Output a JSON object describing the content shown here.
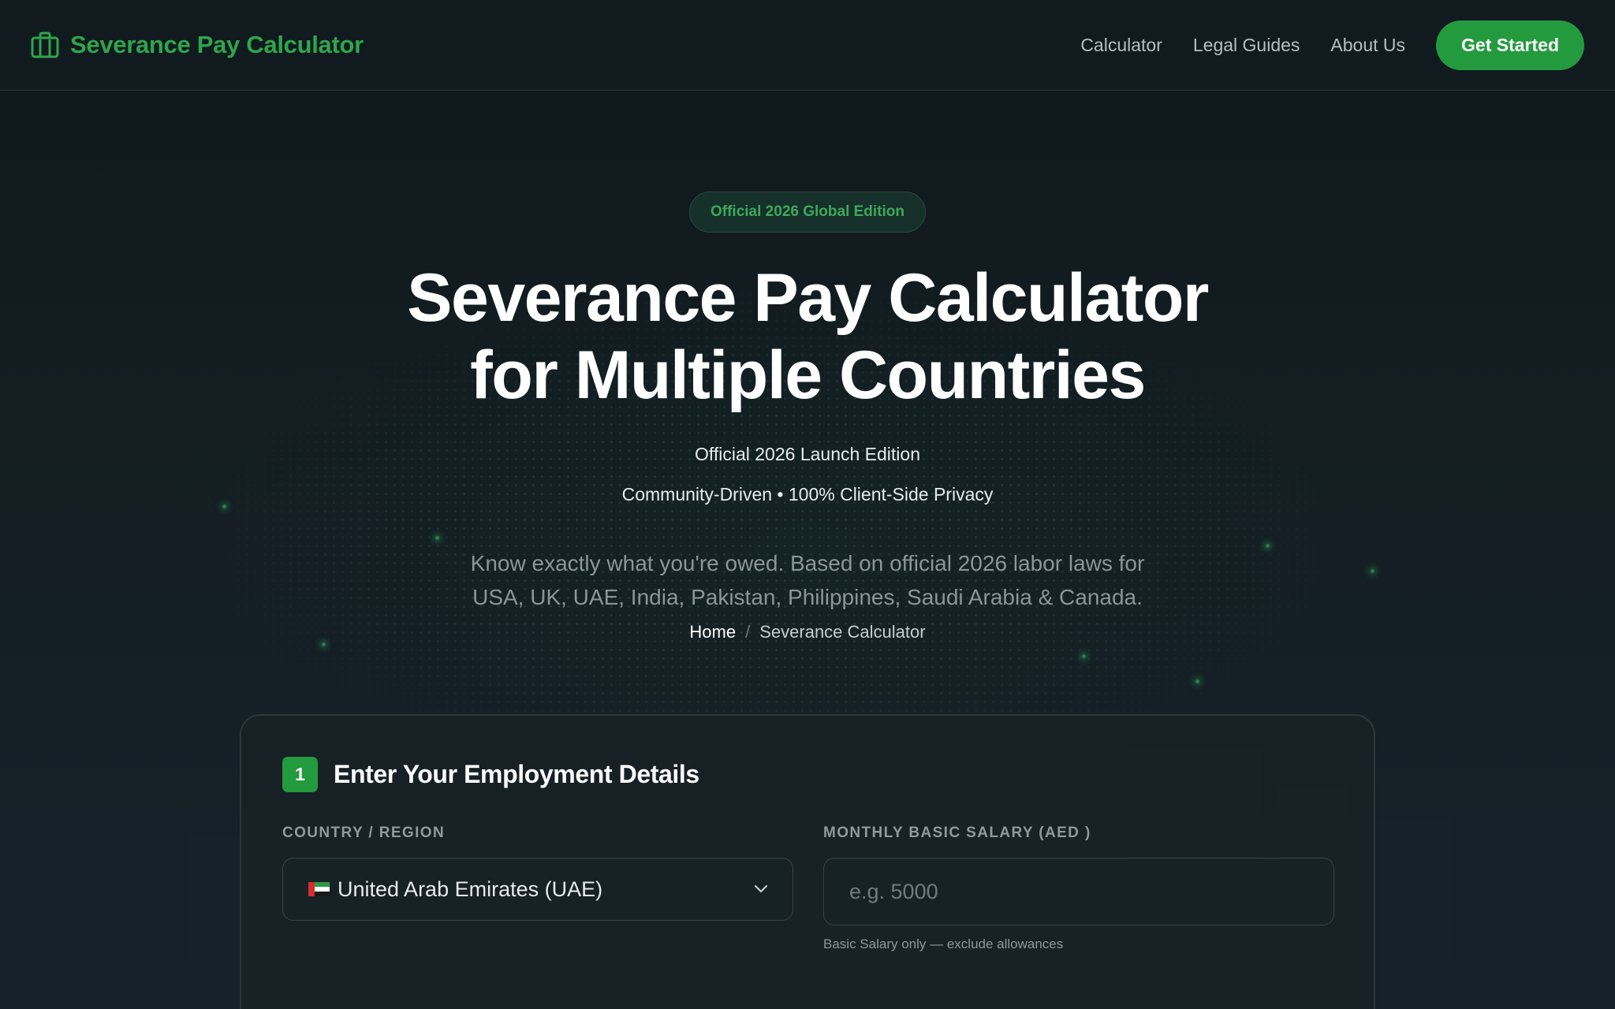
{
  "header": {
    "brand": "Severance Pay Calculator",
    "nav": [
      "Calculator",
      "Legal Guides",
      "About Us"
    ],
    "cta": "Get Started"
  },
  "hero": {
    "badge": "Official 2026 Global Edition",
    "title_line1": "Severance Pay Calculator",
    "title_line2": "for Multiple Countries",
    "subtitle1": "Official 2026 Launch Edition",
    "subtitle2": "Community-Driven • 100% Client-Side Privacy",
    "description": "Know exactly what you're owed. Based on official 2026 labor laws for USA, UK, UAE, India, Pakistan, Philippines, Saudi Arabia & Canada.",
    "breadcrumb": {
      "home": "Home",
      "separator": "/",
      "current": "Severance Calculator"
    }
  },
  "form": {
    "step_number": "1",
    "step_title": "Enter Your Employment Details",
    "country": {
      "label": "COUNTRY / REGION",
      "value": "United Arab Emirates (UAE)",
      "flag": "uae-flag-icon"
    },
    "salary": {
      "label": "MONTHLY BASIC SALARY (AED )",
      "placeholder": "e.g. 5000",
      "hint": "Basic Salary only — exclude allowances"
    }
  },
  "colors": {
    "accent": "#249a3f",
    "brand_text": "#2fa54b",
    "background": "#111a1e"
  }
}
